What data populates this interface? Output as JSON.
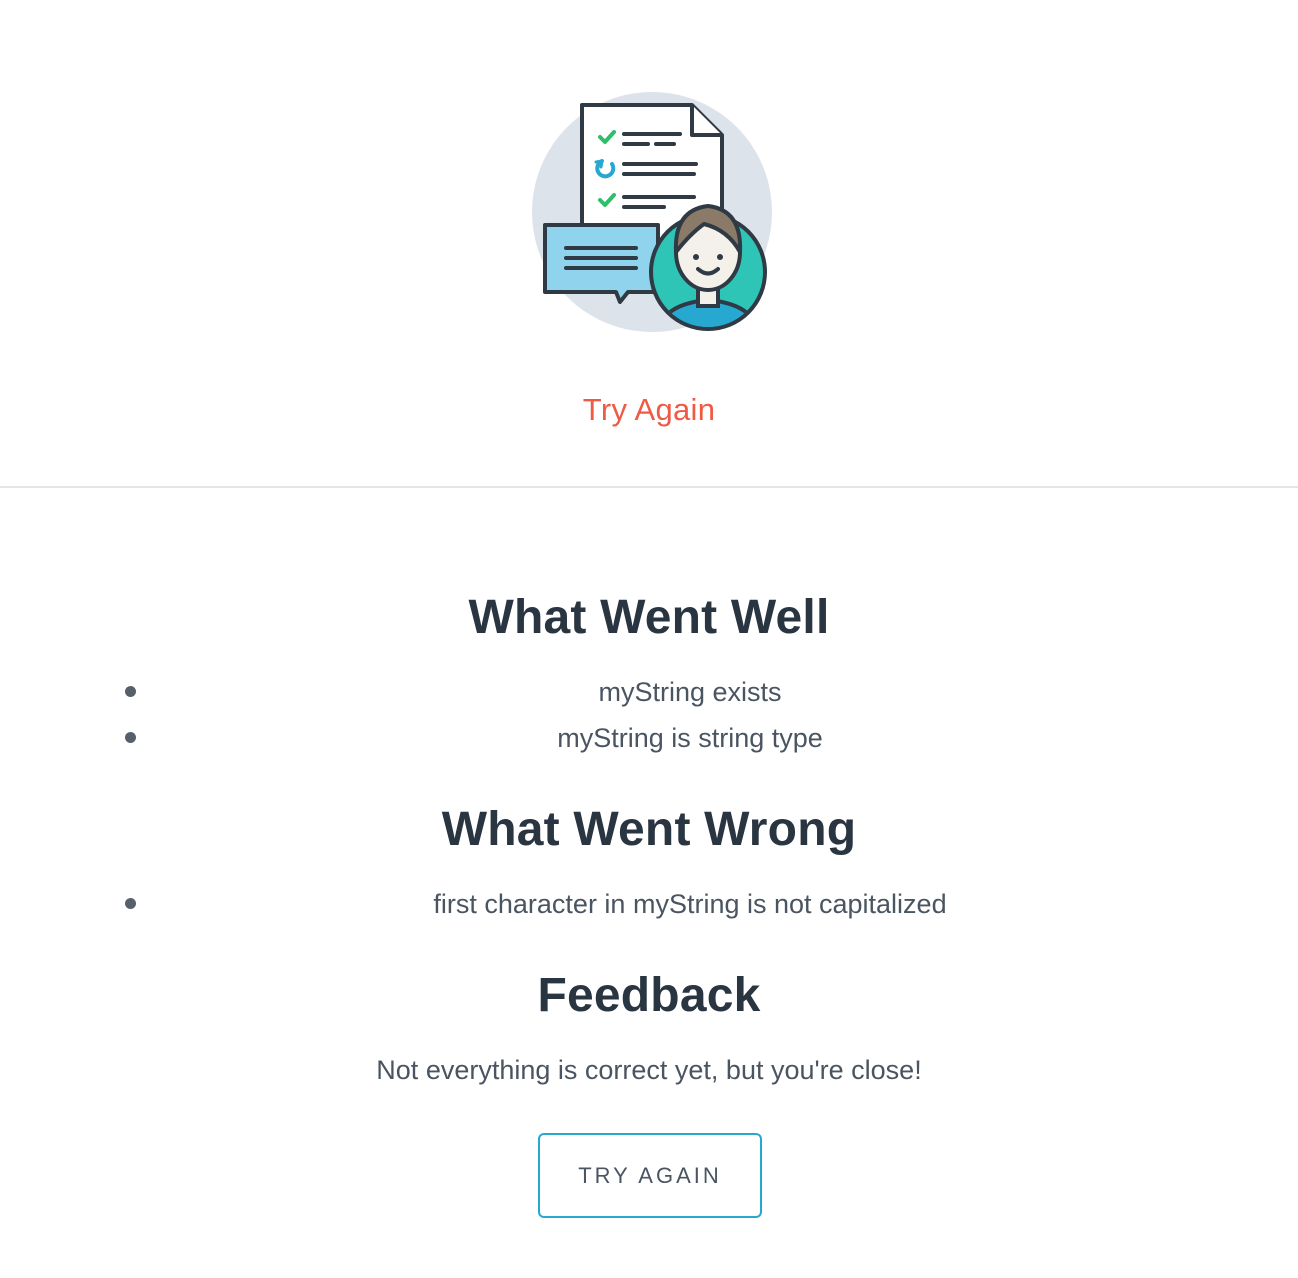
{
  "header": {
    "status_title": "Try Again",
    "illustration_icon": "checklist-feedback-avatar-icon"
  },
  "colors": {
    "status_title": "#ef5a44",
    "button_border": "#27a8d1",
    "heading": "#2a3542",
    "body_text": "#4a5561",
    "check": "#2dbf6b",
    "avatar_bg": "#2ec4b6"
  },
  "results": {
    "well": {
      "heading": "What Went Well",
      "items": [
        "myString exists",
        "myString is string type"
      ]
    },
    "wrong": {
      "heading": "What Went Wrong",
      "items": [
        "first character in myString is not capitalized"
      ]
    },
    "feedback": {
      "heading": "Feedback",
      "message": "Not everything is correct yet, but you're close!"
    }
  },
  "actions": {
    "try_again_label": "TRY AGAIN"
  }
}
